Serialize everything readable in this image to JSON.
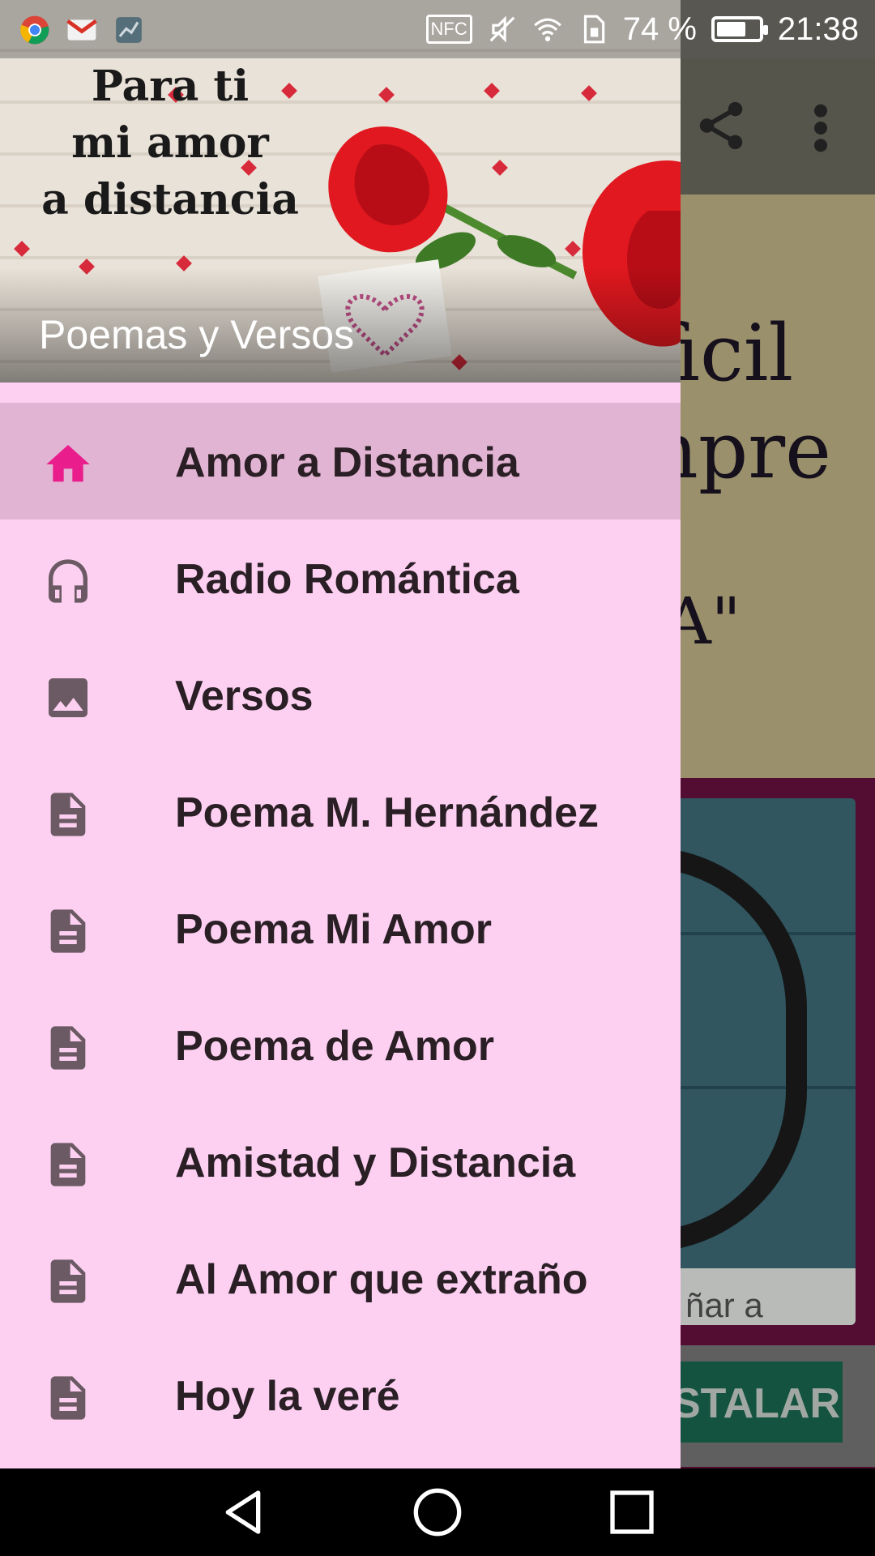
{
  "status_bar": {
    "nfc": "NFC",
    "battery_percent": "74 %",
    "battery_level": 0.74,
    "time": "21:38",
    "apps": [
      "chrome-icon",
      "gmail-icon",
      "analytics-icon"
    ]
  },
  "background_app": {
    "banner_text_1": "ficil",
    "banner_text_2": "npre",
    "banner_text_3": "A\"",
    "card_caption": "ñar a",
    "install_label": "STALAR",
    "colors": {
      "toolbar": "#6f6d60",
      "banner": "#c6b98a",
      "card": "#3f6f7c",
      "install": "#1a6b52"
    }
  },
  "drawer": {
    "header": {
      "quote_line_1": "Para ti",
      "quote_line_2": "mi amor",
      "quote_line_3": "a distancia",
      "title": "Poemas y Versos"
    },
    "items": [
      {
        "label": "Amor a Distancia",
        "icon": "home-icon",
        "active": true
      },
      {
        "label": "Radio Romántica",
        "icon": "headphones-icon",
        "active": false
      },
      {
        "label": "Versos",
        "icon": "image-icon",
        "active": false
      },
      {
        "label": "Poema M. Hernández",
        "icon": "document-icon",
        "active": false
      },
      {
        "label": "Poema Mi Amor",
        "icon": "document-icon",
        "active": false
      },
      {
        "label": "Poema de Amor",
        "icon": "document-icon",
        "active": false
      },
      {
        "label": "Amistad y Distancia",
        "icon": "document-icon",
        "active": false
      },
      {
        "label": "Al Amor que extraño",
        "icon": "document-icon",
        "active": false
      },
      {
        "label": "Hoy la veré",
        "icon": "document-icon",
        "active": false
      }
    ],
    "colors": {
      "background": "#fdd0f2",
      "active_row": "#e2b4d3",
      "active_icon": "#e91e8c",
      "icon": "#6b5a63",
      "text": "#2a1f25"
    }
  },
  "nav_bar": {
    "buttons": [
      "back-button",
      "home-button",
      "recents-button"
    ]
  }
}
